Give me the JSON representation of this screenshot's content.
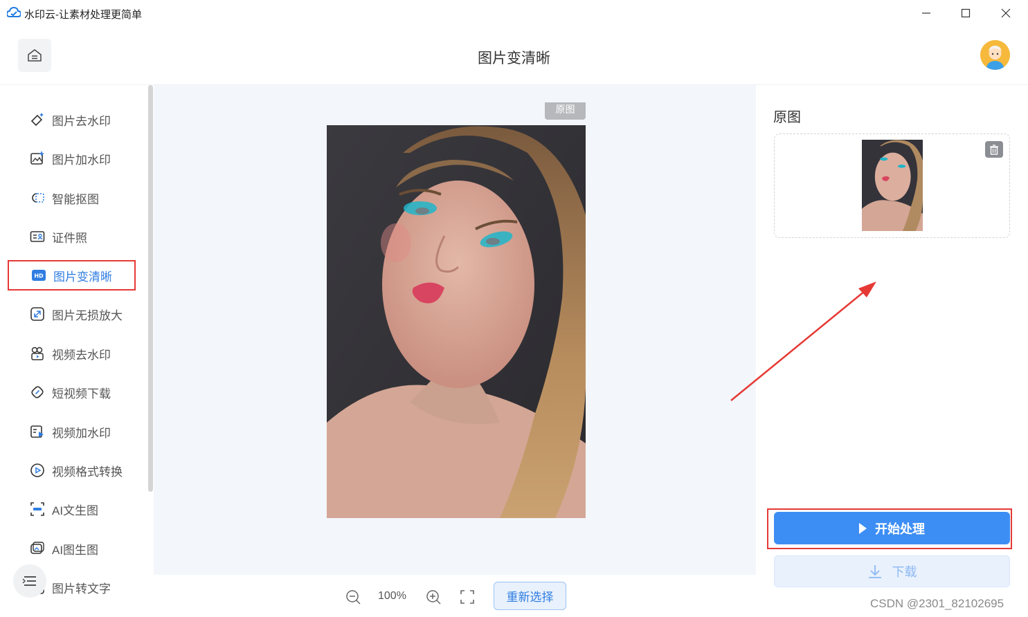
{
  "window": {
    "title": "水印云-让素材处理更简单"
  },
  "header": {
    "title": "图片变清晰"
  },
  "sidebar": {
    "items": [
      {
        "label": "图片去水印",
        "icon": "eraser-icon"
      },
      {
        "label": "图片加水印",
        "icon": "image-add-icon"
      },
      {
        "label": "智能抠图",
        "icon": "cutout-icon"
      },
      {
        "label": "证件照",
        "icon": "id-card-icon"
      },
      {
        "label": "图片变清晰",
        "icon": "hd-icon",
        "active": true
      },
      {
        "label": "图片无损放大",
        "icon": "enlarge-icon"
      },
      {
        "label": "视频去水印",
        "icon": "video-eraser-icon"
      },
      {
        "label": "短视频下载",
        "icon": "link-icon"
      },
      {
        "label": "视频加水印",
        "icon": "video-add-icon"
      },
      {
        "label": "视频格式转换",
        "icon": "play-circle-icon"
      },
      {
        "label": "AI文生图",
        "icon": "ocr-icon"
      },
      {
        "label": "AI图生图",
        "icon": "image-stack-icon"
      },
      {
        "label": "图片转文字",
        "icon": "text-icon"
      }
    ]
  },
  "workspace": {
    "tag": "原图"
  },
  "toolbar": {
    "zoom": "100%",
    "reselect": "重新选择"
  },
  "right_panel": {
    "title": "原图",
    "start_button": "开始处理",
    "download_button": "下载"
  },
  "watermark": "CSDN @2301_82102695",
  "colors": {
    "accent": "#3d8ef4",
    "highlight": "#e53935"
  }
}
